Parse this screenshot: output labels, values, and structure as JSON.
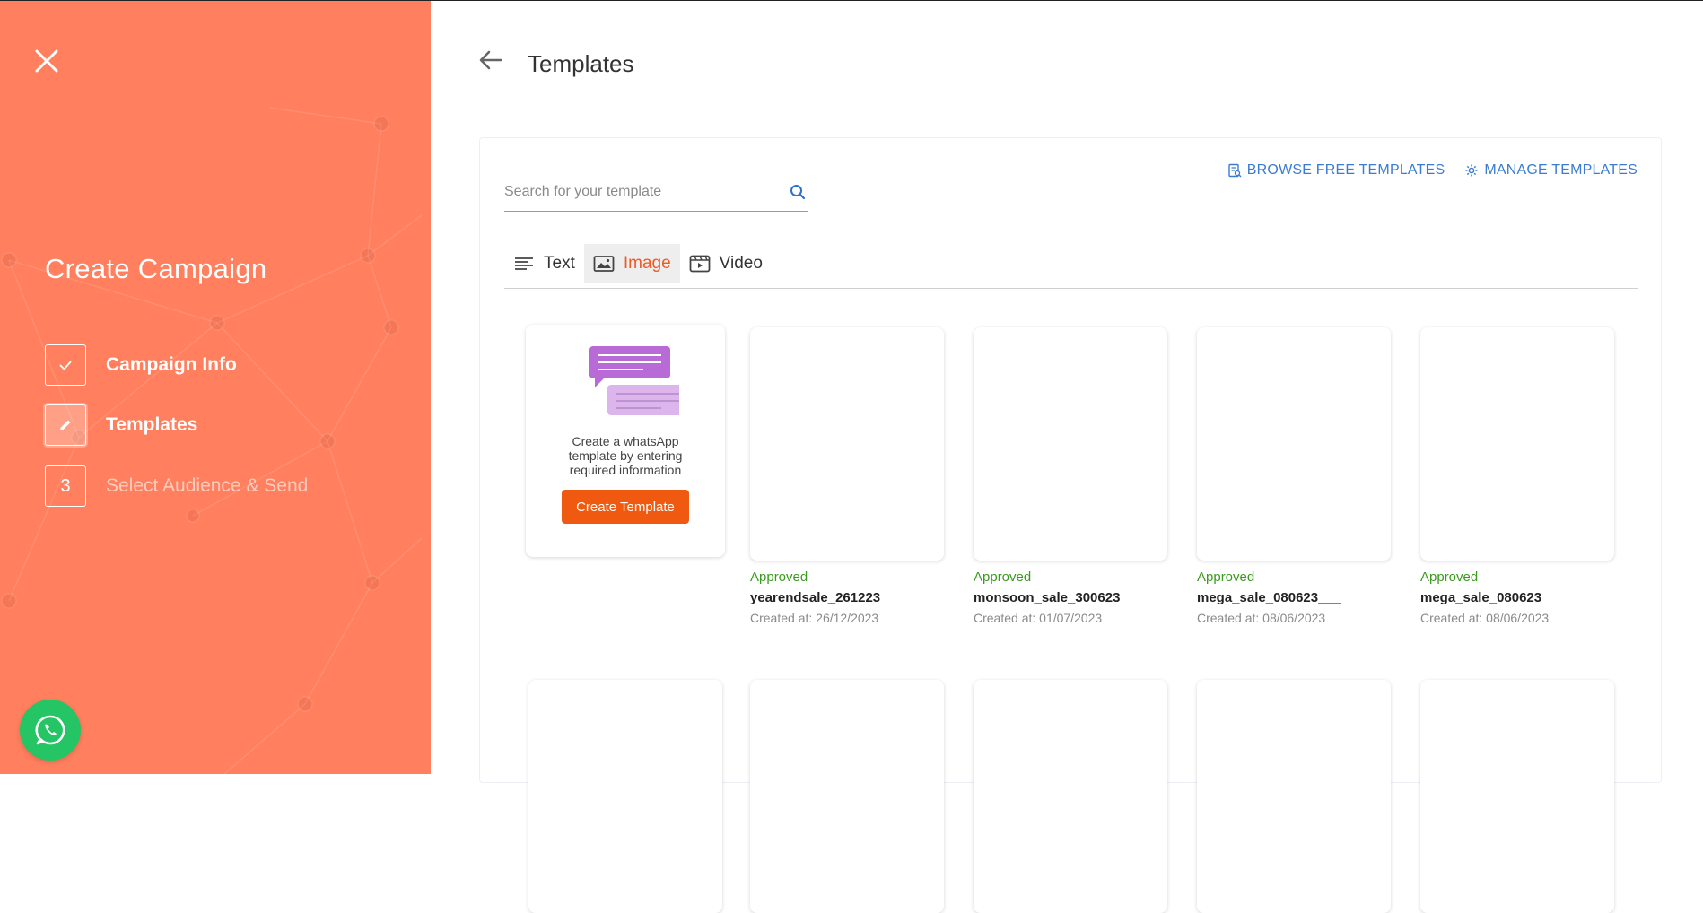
{
  "sidebar": {
    "title": "Create Campaign",
    "steps": [
      {
        "label": "Campaign Info",
        "state": "done",
        "icon": "check-icon"
      },
      {
        "label": "Templates",
        "state": "active",
        "icon": "pencil-icon"
      },
      {
        "label": "Select Audience & Send",
        "state": "pending",
        "number": "3"
      }
    ],
    "accent": "#ff7f5e"
  },
  "header": {
    "title": "Templates"
  },
  "search": {
    "placeholder": "Search for your template",
    "value": ""
  },
  "links": {
    "browse": "BROWSE FREE TEMPLATES",
    "manage": "MANAGE TEMPLATES"
  },
  "tabs": [
    {
      "label": "Text",
      "icon": "text-lines-icon",
      "active": false
    },
    {
      "label": "Image",
      "icon": "image-icon",
      "active": true
    },
    {
      "label": "Video",
      "icon": "video-icon",
      "active": false
    }
  ],
  "create_card": {
    "text": "Create a whatsApp template by entering required information",
    "button": "Create Template"
  },
  "templates": [
    {
      "status": "Approved",
      "name": "yearendsale_261223",
      "created": "Created at: 26/12/2023"
    },
    {
      "status": "Approved",
      "name": "monsoon_sale_300623",
      "created": "Created at: 01/07/2023"
    },
    {
      "status": "Approved",
      "name": "mega_sale_080623___",
      "created": "Created at: 08/06/2023"
    },
    {
      "status": "Approved",
      "name": "mega_sale_080623",
      "created": "Created at: 08/06/2023"
    }
  ],
  "colors": {
    "brand_orange": "#ef5a10",
    "link_blue": "#3a7bd5",
    "approved_green": "#3a9a1e",
    "whatsapp_green": "#25c464"
  }
}
